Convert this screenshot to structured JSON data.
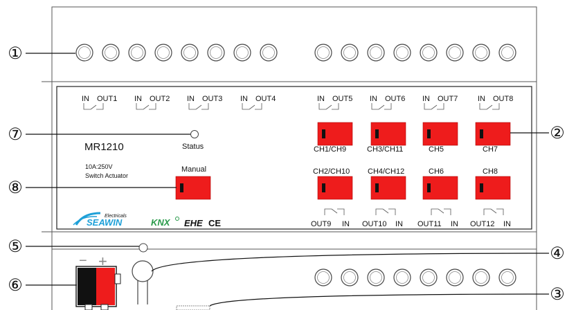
{
  "callouts": [
    {
      "id": "1",
      "label": "①"
    },
    {
      "id": "2",
      "label": "②"
    },
    {
      "id": "3",
      "label": "③"
    },
    {
      "id": "4",
      "label": "④"
    },
    {
      "id": "5",
      "label": "⑤"
    },
    {
      "id": "6",
      "label": "⑥"
    },
    {
      "id": "7",
      "label": "⑦"
    },
    {
      "id": "8",
      "label": "⑧"
    }
  ],
  "device": {
    "model": "MR1210",
    "rating": "10A:250V",
    "type": "Switch Actuator",
    "status_label": "Status",
    "manual_label": "Manual"
  },
  "top_contacts": [
    {
      "in": "IN",
      "out": "OUT1"
    },
    {
      "in": "IN",
      "out": "OUT2"
    },
    {
      "in": "IN",
      "out": "OUT3"
    },
    {
      "in": "IN",
      "out": "OUT4"
    },
    {
      "in": "IN",
      "out": "OUT5"
    },
    {
      "in": "IN",
      "out": "OUT6"
    },
    {
      "in": "IN",
      "out": "OUT7"
    },
    {
      "in": "IN",
      "out": "OUT8"
    }
  ],
  "bottom_contacts": [
    {
      "out": "OUT9",
      "in": "IN"
    },
    {
      "out": "OUT10",
      "in": "IN"
    },
    {
      "out": "OUT11",
      "in": "IN"
    },
    {
      "out": "OUT12",
      "in": "IN"
    }
  ],
  "channel_switches": [
    {
      "label": "CH1/CH9"
    },
    {
      "label": "CH3/CH11"
    },
    {
      "label": "CH5"
    },
    {
      "label": "CH7"
    },
    {
      "label": "CH2/CH10"
    },
    {
      "label": "CH4/CH12"
    },
    {
      "label": "CH6"
    },
    {
      "label": "CH8"
    }
  ],
  "logos": {
    "brand_small": "Electricals",
    "brand": "SEAWIN",
    "knx": "KNX",
    "eac": "EHE",
    "ce": "CE"
  },
  "bus_terminal": {
    "minus": "−",
    "plus": "+"
  },
  "colors": {
    "switch_red": "#ee1c1c",
    "brand_blue": "#1ea0d8",
    "knx_green": "#2a9a4a",
    "outline": "#333333"
  }
}
